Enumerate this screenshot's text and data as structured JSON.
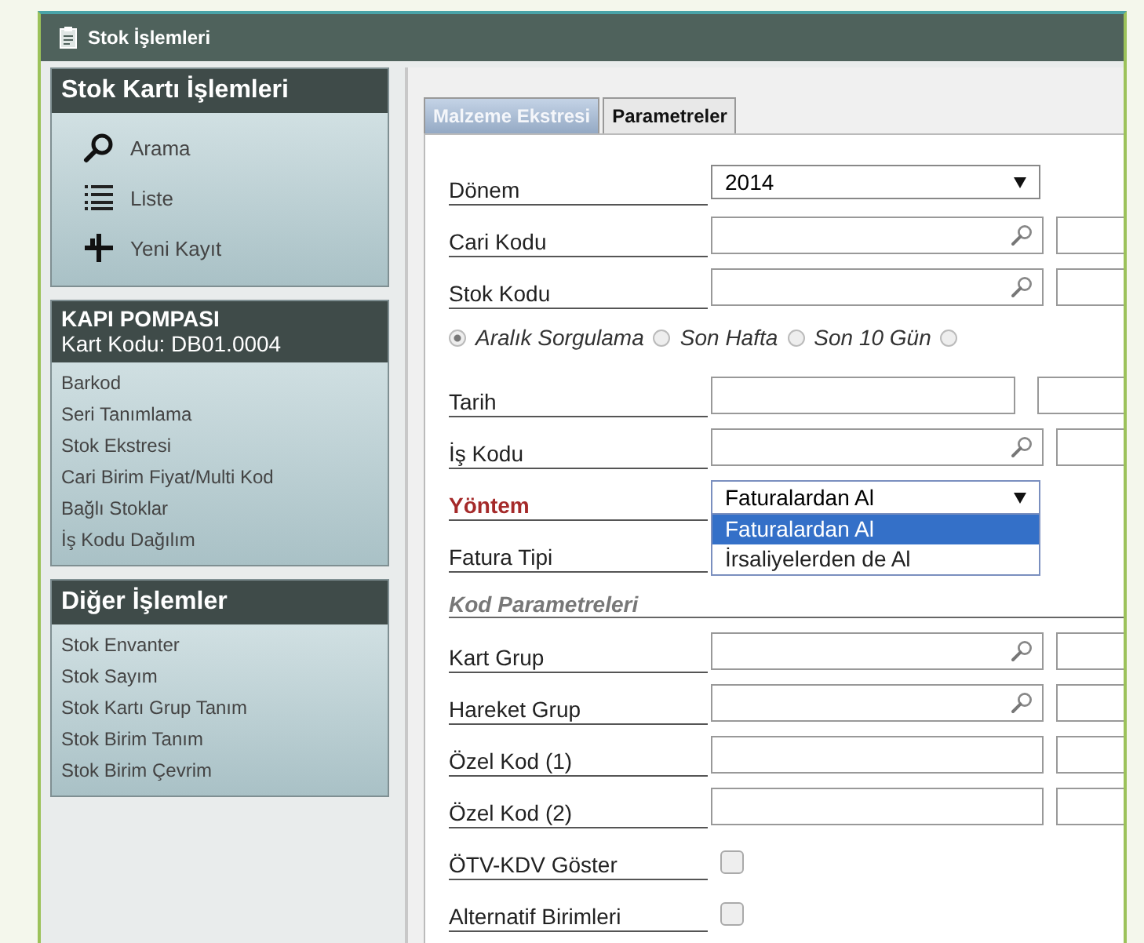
{
  "window": {
    "title": "Stok İşlemleri"
  },
  "sidebar": {
    "sections": [
      {
        "title": "Stok Kartı İşlemleri",
        "items": [
          {
            "label": "Arama",
            "kind": "search"
          },
          {
            "label": "Liste",
            "kind": "list"
          },
          {
            "label": "Yeni Kayıt",
            "kind": "add"
          }
        ]
      },
      {
        "title": "KAPI POMPASI",
        "subtitle": "Kart Kodu: DB01.0004",
        "items": [
          {
            "label": "Barkod"
          },
          {
            "label": "Seri Tanımlama"
          },
          {
            "label": "Stok Ekstresi"
          },
          {
            "label": "Cari Birim Fiyat/Multi Kod"
          },
          {
            "label": "Bağlı Stoklar"
          },
          {
            "label": "İş Kodu Dağılım"
          }
        ]
      },
      {
        "title": "Diğer İşlemler",
        "items": [
          {
            "label": "Stok Envanter"
          },
          {
            "label": "Stok Sayım"
          },
          {
            "label": "Stok Kartı Grup Tanım"
          },
          {
            "label": "Stok Birim Tanım"
          },
          {
            "label": "Stok Birim Çevrim"
          }
        ]
      }
    ]
  },
  "tabs": [
    {
      "label": "Malzeme Ekstresi",
      "selected": true
    },
    {
      "label": "Parametreler",
      "selected": false
    }
  ],
  "form": {
    "rows": [
      {
        "kind": "select",
        "label": "Dönem",
        "value": "2014",
        "required": false,
        "expanded": false
      },
      {
        "kind": "lookup",
        "label": "Cari Kodu"
      },
      {
        "kind": "lookup",
        "label": "Stok Kodu"
      },
      {
        "kind": "radios",
        "options": [
          {
            "label": "Aralık Sorgulama",
            "selected": true
          },
          {
            "label": "Son Hafta",
            "selected": false
          },
          {
            "label": "Son 10 Gün",
            "selected": false
          },
          {
            "selected": false
          }
        ]
      },
      {
        "kind": "date",
        "label": "Tarih"
      },
      {
        "kind": "lookup",
        "label": "İş Kodu"
      },
      {
        "kind": "select",
        "label": "Yöntem",
        "value": "Faturalardan Al",
        "required": true,
        "expanded": true,
        "options": [
          {
            "label": "Faturalardan Al",
            "selected": true
          },
          {
            "label": "İrsaliyelerden de Al",
            "selected": false
          }
        ]
      },
      {
        "kind": "plain",
        "label": "Fatura Tipi"
      },
      {
        "kind": "section",
        "label": "Kod Parametreleri"
      },
      {
        "kind": "lookup",
        "label": "Kart Grup"
      },
      {
        "kind": "lookup",
        "label": "Hareket Grup"
      },
      {
        "kind": "text",
        "label": "Özel Kod (1)"
      },
      {
        "kind": "text",
        "label": "Özel Kod (2)"
      },
      {
        "kind": "checkbox",
        "label": "ÖTV-KDV Göster",
        "checked": false
      },
      {
        "kind": "checkbox",
        "label": "Alternatif Birimleri",
        "checked": false
      }
    ]
  }
}
